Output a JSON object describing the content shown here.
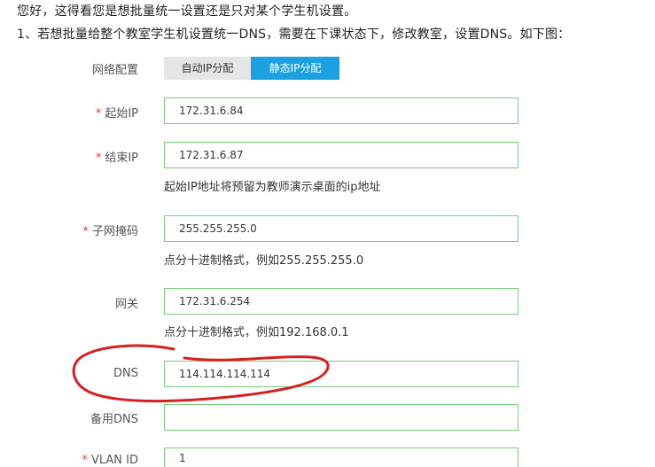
{
  "intro": {
    "line1": "您好，这得看您是想批量统一设置还是只对某个学生机设置。",
    "line2": "1、若想批量给整个教室学生机设置统一DNS，需要在下课状态下，修改教室，设置DNS。如下图："
  },
  "form": {
    "network_config": {
      "label": "网络配置",
      "options": [
        "自动IP分配",
        "静态IP分配"
      ],
      "selected": "静态IP分配"
    },
    "start_ip": {
      "required_mark": "*",
      "label": "起始IP",
      "value": "172.31.6.84"
    },
    "end_ip": {
      "required_mark": "*",
      "label": "结束IP",
      "value": "172.31.6.87",
      "hint": "起始IP地址将预留为教师演示桌面的ip地址"
    },
    "subnet_mask": {
      "required_mark": "*",
      "label": "子网掩码",
      "value": "255.255.255.0",
      "hint": "点分十进制格式，例如255.255.255.0"
    },
    "gateway": {
      "label": "网关",
      "value": "172.31.6.254",
      "hint": "点分十进制格式，例如192.168.0.1"
    },
    "dns": {
      "label": "DNS",
      "value": "114.114.114.114"
    },
    "backup_dns": {
      "label": "备用DNS",
      "value": ""
    },
    "vlan_id": {
      "required_mark": "*",
      "label": "VLAN ID",
      "value": "1"
    }
  },
  "colors": {
    "accent": "#1ba1e2",
    "required": "#e4393c",
    "field_border": "#7ccb7c",
    "annotation": "#d61f1f"
  }
}
